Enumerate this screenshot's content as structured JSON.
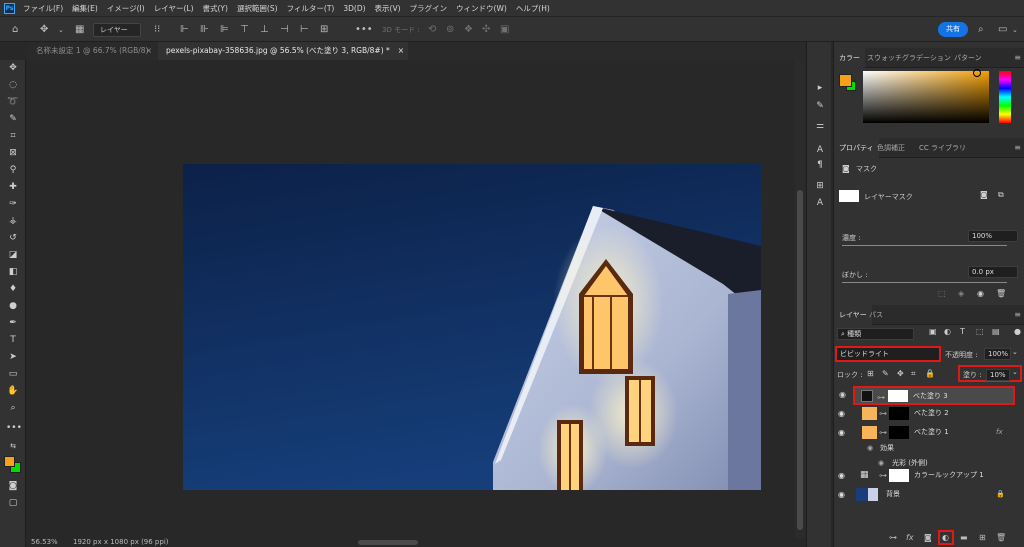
{
  "menu": [
    "ファイル(F)",
    "編集(E)",
    "イメージ(I)",
    "レイヤー(L)",
    "書式(Y)",
    "選択範囲(S)",
    "フィルター(T)",
    "3D(D)",
    "表示(V)",
    "プラグイン",
    "ウィンドウ(W)",
    "ヘルプ(H)"
  ],
  "app_icon": "Ps",
  "options": {
    "layer_select": "レイヤー",
    "mode_3d": "3D モード :",
    "share": "共有"
  },
  "tabs": [
    "名称未設定 1 @ 66.7% (RGB/8)",
    "pexels-pixabay-358636.jpg @ 56.5% (べた塗り 3, RGB/8#) *"
  ],
  "status": {
    "zoom": "56.53%",
    "dims": "1920 px x 1080 px (96 ppi)"
  },
  "colors": {
    "foreground": "#f7a11a",
    "background": "#00e000",
    "accent": "#1473e6",
    "highlight": "#e01818"
  },
  "color_panel": {
    "tabs": [
      "カラー",
      "スウォッチ",
      "グラデーション",
      "パターン"
    ],
    "hue_color": "#f29f05"
  },
  "properties": {
    "tabs": [
      "プロパティ",
      "色調補正",
      "CC ライブラリ"
    ],
    "mask_label": "マスク",
    "layer_mask_label": "レイヤーマスク",
    "density_label": "濃度 :",
    "density_value": "100%",
    "feather_label": "ぼかし :",
    "feather_value": "0.0 px"
  },
  "layers_panel": {
    "tabs": [
      "レイヤー",
      "パス"
    ],
    "filter_label": "種類",
    "blend_mode": "ビビッドライト",
    "opacity_label": "不透明度 :",
    "opacity_value": "100%",
    "lock_label": "ロック :",
    "fill_label": "塗り :",
    "fill_value": "10%",
    "layers": [
      {
        "name": "べた塗り 3",
        "swatch": "#111111",
        "mask": "#ffffff",
        "selected": true
      },
      {
        "name": "べた塗り 2",
        "swatch": "#f7b45a",
        "mask": "#000000",
        "selected": false
      },
      {
        "name": "べた塗り 1",
        "swatch": "#f7b45a",
        "mask": "#000000",
        "selected": false,
        "fx": "fx"
      },
      {
        "name": "効果",
        "sub": true
      },
      {
        "name": "光彩 (外側)",
        "sub2": true
      },
      {
        "name": "カラールックアップ 1",
        "adjust": true
      },
      {
        "name": "背景",
        "background": true
      }
    ]
  }
}
